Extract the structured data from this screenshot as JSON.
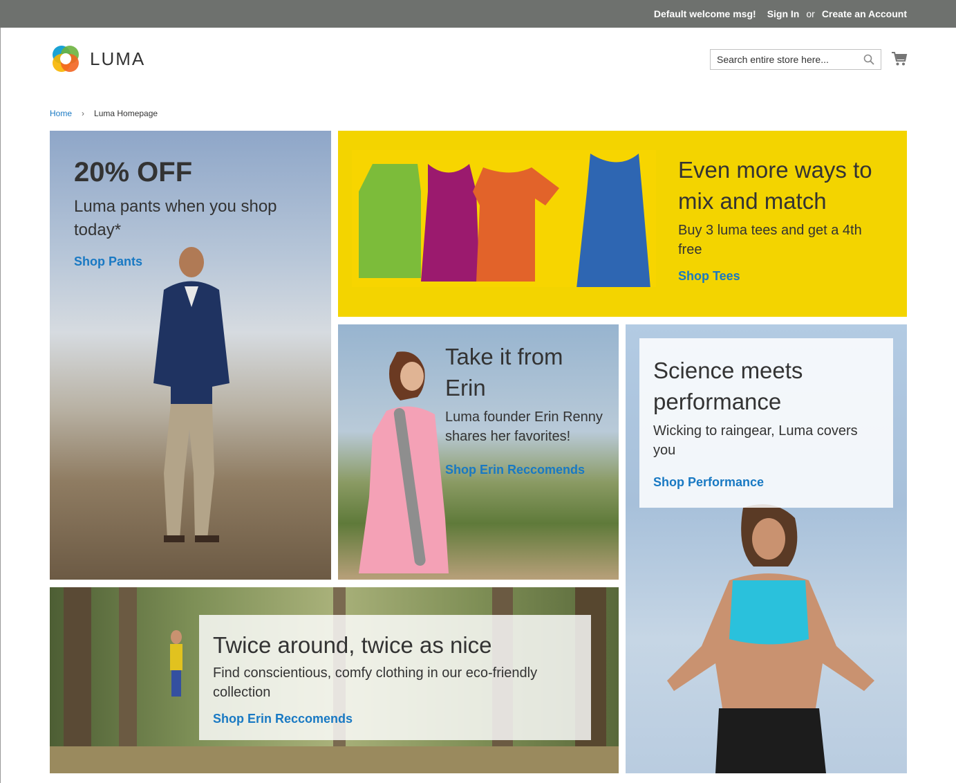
{
  "header": {
    "welcome": "Default welcome msg!",
    "sign_in": "Sign In",
    "or": "or",
    "create_account": "Create an Account"
  },
  "logo": {
    "name": "LUMA"
  },
  "search": {
    "placeholder": "Search entire store here..."
  },
  "breadcrumb": {
    "home": "Home",
    "current": "Luma Homepage"
  },
  "tiles": {
    "pants": {
      "heading": "20% OFF",
      "text": "Luma pants when you shop today*",
      "link": "Shop Pants"
    },
    "tees": {
      "heading": "Even more ways to mix and match",
      "text": "Buy 3 luma tees and get a 4th free",
      "link": "Shop Tees"
    },
    "erin": {
      "heading": "Take it from Erin",
      "text": "Luma founder Erin Renny shares her favorites!",
      "link": "Shop Erin Reccomends"
    },
    "performance": {
      "heading": "Science meets performance",
      "text": "Wicking to raingear, Luma covers you",
      "link": "Shop Performance"
    },
    "eco": {
      "heading": "Twice around, twice as nice",
      "text": "Find conscientious, comfy clothing in our eco-friendly collection",
      "link": "Shop Erin Reccomends"
    }
  },
  "colors": {
    "link": "#1979c3",
    "topbar": "#6e716e",
    "tees_bg": "#f3d400"
  }
}
